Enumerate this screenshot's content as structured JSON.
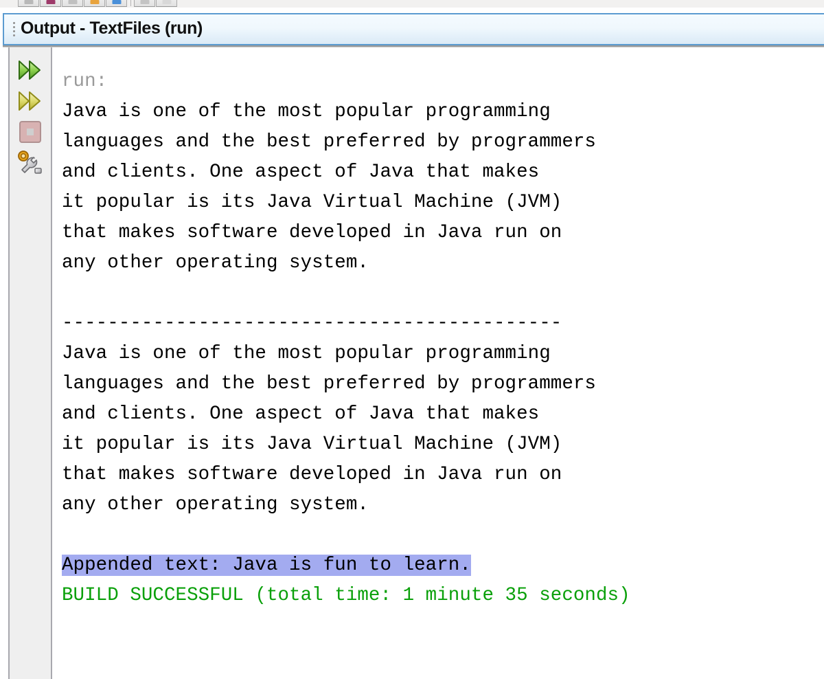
{
  "toolbar": {
    "buttons": [
      {
        "name": "toolbar-button-1",
        "accent": "#b8b8b8"
      },
      {
        "name": "toolbar-button-2",
        "accent": "#9e3a6a"
      },
      {
        "name": "toolbar-button-3",
        "accent": "#c0c0c0"
      },
      {
        "name": "toolbar-button-4",
        "accent": "#e8a33d"
      },
      {
        "name": "toolbar-button-5",
        "accent": "#4a90d9"
      },
      {
        "name": "toolbar-button-6",
        "accent": "#c4c4c4"
      },
      {
        "name": "toolbar-button-7",
        "accent": "#d8d8d8"
      }
    ]
  },
  "window": {
    "title": "Output - TextFiles (run)",
    "border_color": "#5b9bd0",
    "title_bg": "#e9f4fb"
  },
  "gutter": {
    "buttons": [
      {
        "name": "rerun-button",
        "icon": "double-chevron-right-green-icon",
        "title": "Re-run",
        "color": "#4a9b28"
      },
      {
        "name": "rerun-other-button",
        "icon": "double-chevron-right-yellow-icon",
        "title": "Re-run with different parameters",
        "color": "#b5b32a"
      },
      {
        "name": "stop-button",
        "icon": "stop-square-icon",
        "title": "Stop",
        "color": "#c9a0a0"
      },
      {
        "name": "settings-button",
        "icon": "wrench-target-icon",
        "title": "Settings",
        "color": "#c8870d"
      }
    ]
  },
  "output": {
    "colors": {
      "run_label": "#9a9a9a",
      "body_text": "#000000",
      "success_text": "#0aa00a",
      "selection_bg": "#a3abf0"
    },
    "lines": [
      {
        "style": "run",
        "text": "run:"
      },
      {
        "style": "normal",
        "text": "Java is one of the most popular programming"
      },
      {
        "style": "normal",
        "text": "languages and the best preferred by programmers"
      },
      {
        "style": "normal",
        "text": "and clients. One aspect of Java that makes"
      },
      {
        "style": "normal",
        "text": "it popular is its Java Virtual Machine (JVM)"
      },
      {
        "style": "normal",
        "text": "that makes software developed in Java run on"
      },
      {
        "style": "normal",
        "text": "any other operating system."
      },
      {
        "style": "blank",
        "text": " "
      },
      {
        "style": "normal",
        "text": "--------------------------------------------"
      },
      {
        "style": "normal",
        "text": "Java is one of the most popular programming"
      },
      {
        "style": "normal",
        "text": "languages and the best preferred by programmers"
      },
      {
        "style": "normal",
        "text": "and clients. One aspect of Java that makes"
      },
      {
        "style": "normal",
        "text": "it popular is its Java Virtual Machine (JVM)"
      },
      {
        "style": "normal",
        "text": "that makes software developed in Java run on"
      },
      {
        "style": "normal",
        "text": "any other operating system."
      },
      {
        "style": "blank",
        "text": " "
      },
      {
        "style": "hl",
        "text": "Appended text: Java is fun to learn."
      },
      {
        "style": "success",
        "text": "BUILD SUCCESSFUL (total time: 1 minute 35 seconds)"
      }
    ]
  }
}
